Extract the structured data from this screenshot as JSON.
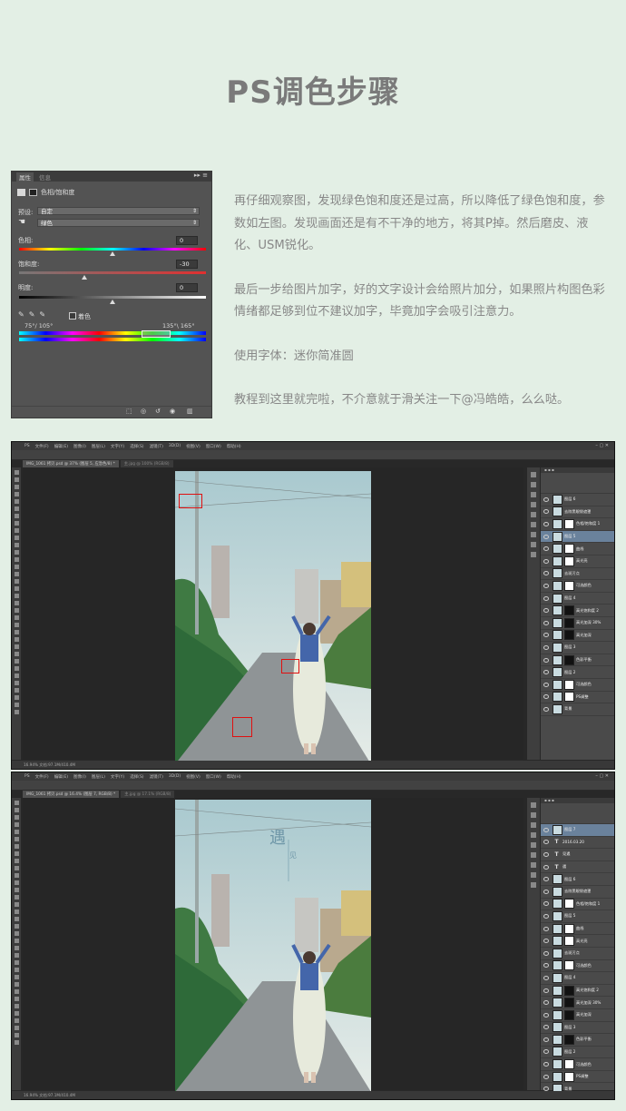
{
  "page_title": "PS调色步骤",
  "properties_panel": {
    "tabs": [
      "属性",
      "信息"
    ],
    "menu_glyph": "▸▸ ≡",
    "header_label": "色相/饱和度",
    "preset_label": "预设:",
    "preset_value": "自定",
    "channel_value": "绿色",
    "hue_label": "色相:",
    "hue_value": "0",
    "saturation_label": "饱和度:",
    "saturation_value": "-30",
    "lightness_label": "明度:",
    "lightness_value": "0",
    "colorize_label": "着色",
    "range_left": "75°/ 105°",
    "range_right": "135°\\ 165°",
    "hue_level": 0.5,
    "saturation_level": 0.35,
    "lightness_level": 0.5
  },
  "description": {
    "p1": "再仔细观察图，发现绿色饱和度还是过高，所以降低了绿色饱和度，参数如左图。发现画面还是有不干净的地方，将其P掉。然后磨皮、液化、USM锐化。",
    "p2": "最后一步给图片加字，好的文字设计会给照片加分，如果照片构图色彩情绪都足够到位不建议加字，毕竟加字会吸引注意力。",
    "p3": "使用字体：迷你简准圆",
    "p4": "教程到这里就完啦，不介意就于滑关注一下@冯皓皓，么么哒。"
  },
  "screenshot1": {
    "menu": [
      "PS",
      "文件(F)",
      "编辑(E)",
      "图像(I)",
      "图层(L)",
      "文字(Y)",
      "选择(S)",
      "滤镜(T)",
      "3D(D)",
      "视图(V)",
      "窗口(W)",
      "帮助(H)"
    ],
    "doc_tabs": [
      "IMG_1061 拷贝.psd @ 37% (图层 5, 应急色/8) *",
      "主.jpg @ 100% (RGB/8)"
    ],
    "status": "16.94%   文档:97.1M/410.4M",
    "layers": [
      "图层 6",
      "去除黑眼袋遮罩",
      "色相/饱和度 1",
      "图层 5",
      "曲线",
      "高光亮",
      "去斑污点",
      "可选颜色",
      "图层 4",
      "高光饱和度 2",
      "高光加深 30%",
      "高光加深",
      "图层 3",
      "色彩平衡",
      "图层 2",
      "可选颜色",
      "PS调整",
      "背景"
    ],
    "selected_layer": 3
  },
  "screenshot2": {
    "menu": [
      "PS",
      "文件(F)",
      "编辑(E)",
      "图像(I)",
      "图层(L)",
      "文字(Y)",
      "选择(S)",
      "滤镜(T)",
      "3D(D)",
      "视图(V)",
      "窗口(W)",
      "帮助(H)"
    ],
    "doc_tabs": [
      "IMG_1061 拷贝.psd @ 16.4% (图层 7, RGB/8) *",
      "主.jpg @ 17.1% (RGB/8)"
    ],
    "status": "16.94%   文档:97.1M/410.4M",
    "overlay_title": "遇",
    "overlay_sub": "见",
    "layers": [
      "图层 7",
      "2016.03.20",
      "見遇",
      "遇",
      "图层 6",
      "去除黑眼袋遮罩",
      "色相/饱和度 1",
      "图层 5",
      "曲线",
      "高光亮",
      "去斑污点",
      "可选颜色",
      "图层 4",
      "高光饱和度 2",
      "高光加深 30%",
      "高光加深",
      "图层 3",
      "色彩平衡",
      "图层 2",
      "可选颜色",
      "PS调整",
      "背景"
    ],
    "selected_layer": 0
  },
  "colors": {
    "background": "#e3efe5",
    "title": "#7a7a7a",
    "text": "#888888",
    "ps_dark": "#282828",
    "selection": "#6a829c",
    "marker": "#e01010"
  }
}
